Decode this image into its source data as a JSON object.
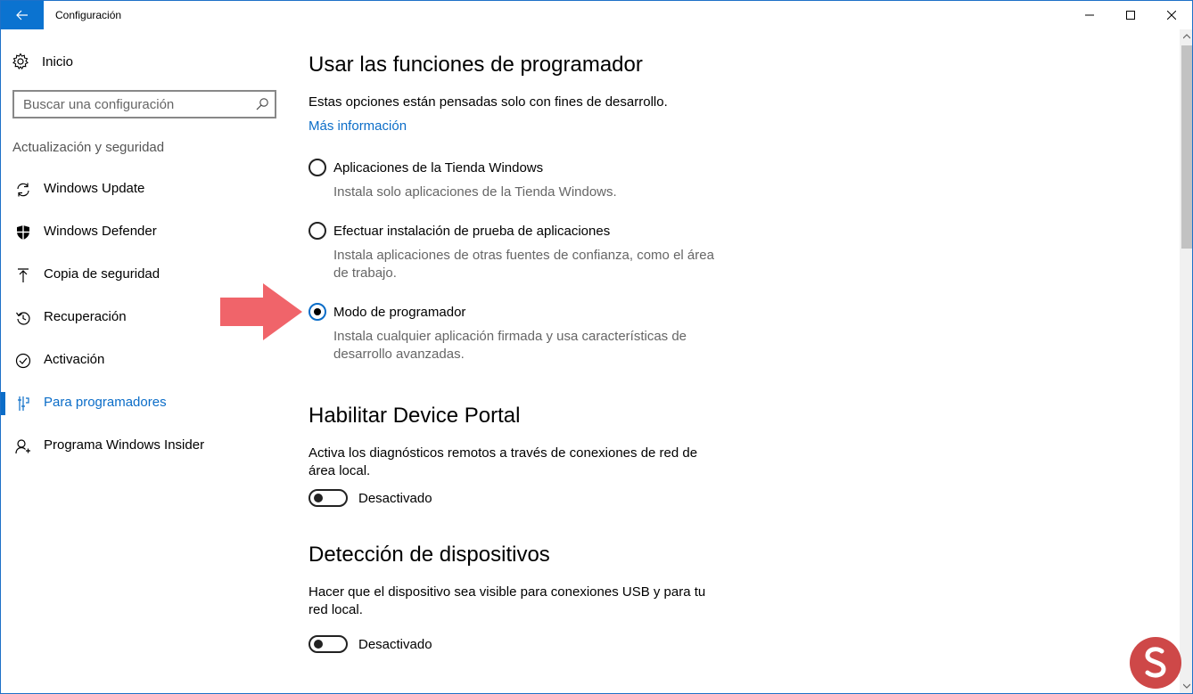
{
  "window": {
    "title": "Configuración"
  },
  "sidebar": {
    "home_label": "Inicio",
    "search_placeholder": "Buscar una configuración",
    "section_header": "Actualización y seguridad",
    "items": [
      {
        "label": "Windows Update",
        "icon": "sync-icon",
        "active": false
      },
      {
        "label": "Windows Defender",
        "icon": "shield-icon",
        "active": false
      },
      {
        "label": "Copia de seguridad",
        "icon": "backup-icon",
        "active": false
      },
      {
        "label": "Recuperación",
        "icon": "recovery-icon",
        "active": false
      },
      {
        "label": "Activación",
        "icon": "activation-icon",
        "active": false
      },
      {
        "label": "Para programadores",
        "icon": "developer-icon",
        "active": true
      },
      {
        "label": "Programa Windows Insider",
        "icon": "insider-icon",
        "active": false
      }
    ]
  },
  "content": {
    "title": "Usar las funciones de programador",
    "intro": "Estas opciones están pensadas solo con fines de desarrollo.",
    "more_info": "Más información",
    "options": [
      {
        "label": "Aplicaciones de la Tienda Windows",
        "desc_line1": "Instala solo aplicaciones de la Tienda Windows.",
        "desc_line2": "",
        "checked": false
      },
      {
        "label": "Efectuar instalación de prueba de aplicaciones",
        "desc_line1": "Instala aplicaciones de otras fuentes de confianza, como el área",
        "desc_line2": "de trabajo.",
        "checked": false
      },
      {
        "label": "Modo de programador",
        "desc_line1": "Instala cualquier aplicación firmada y usa características de",
        "desc_line2": "desarrollo avanzadas.",
        "checked": true
      }
    ],
    "device_portal": {
      "title": "Habilitar Device Portal",
      "desc_line1": "Activa los diagnósticos remotos a través de conexiones de red de",
      "desc_line2": "área local.",
      "toggle_label": "Desactivado",
      "toggle_on": false
    },
    "discovery": {
      "title": "Detección de dispositivos",
      "desc_line1": "Hacer que el dispositivo sea visible para conexiones USB y para tu",
      "desc_line2": "red local.",
      "toggle_label": "Desactivado",
      "toggle_on": false
    }
  },
  "colors": {
    "accent": "#0b6dc8",
    "annotation_arrow": "#f0646a"
  }
}
